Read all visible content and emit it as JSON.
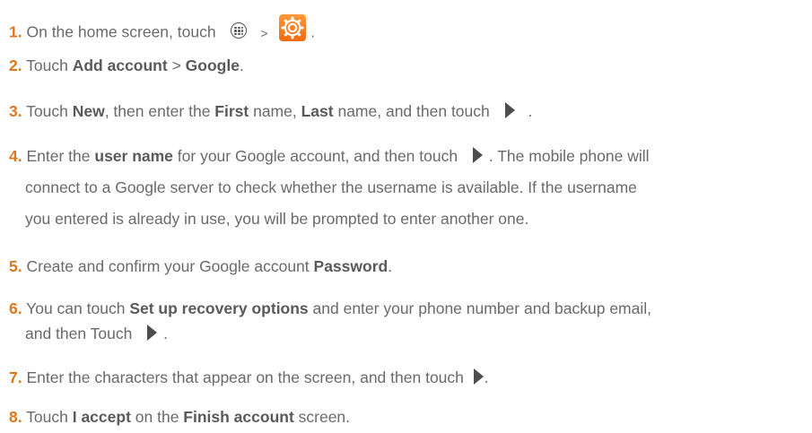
{
  "steps": [
    {
      "num": "1.",
      "t1": "On the home screen, touch",
      "gt": ">",
      "end": "."
    },
    {
      "num": "2.",
      "t1": "Touch ",
      "b1": "Add account",
      "t2": " > ",
      "b2": "Google",
      "t3": "."
    },
    {
      "num": "3.",
      "t1": "Touch ",
      "b1": "New",
      "t2": ", then enter the ",
      "b2": "First",
      "t3": " name, ",
      "b3": "Last",
      "t4": " name, and then touch",
      "end": "."
    },
    {
      "num": "4.",
      "t1": "Enter the ",
      "b1": "user name",
      "t2": " for your Google account, and then touch",
      "t3": ". The mobile phone will",
      "line2": "connect to a Google server to check whether the username is available. If the username",
      "line3": "you entered is already in use, you will be prompted to enter another one."
    },
    {
      "num": "5.",
      "t1": "Create and confirm your Google account ",
      "b1": "Password",
      "t2": "."
    },
    {
      "num": "6.",
      "t1": "You can touch ",
      "b1": "Set up recovery options",
      "t2": " and enter your phone number and backup email,",
      "line2": "and then Touch",
      "end": "."
    },
    {
      "num": "7.",
      "t1": "Enter the characters that appear on the screen, and then touch",
      "end": "."
    },
    {
      "num": "8.",
      "t1": "Touch ",
      "b1": "I accept",
      "t2": " on the ",
      "b2": "Finish account",
      "t3": " screen."
    }
  ],
  "icons": {
    "apps": "all-apps-icon",
    "settings": "settings-gear-icon",
    "next": "next-arrow-icon"
  },
  "colors": {
    "step_number": "#e0771e",
    "text": "#6a6a6a",
    "settings_icon": "#f07a1e"
  }
}
